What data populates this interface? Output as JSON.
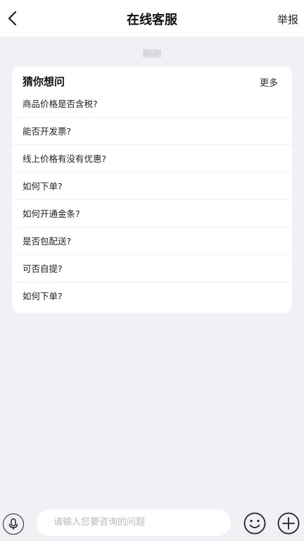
{
  "header": {
    "title": "在线客服",
    "report_label": "举报",
    "back_icon": "chevron-left-icon"
  },
  "chat": {
    "timestamp": "刚刚"
  },
  "faq_card": {
    "title": "猜你想问",
    "more_label": "更多",
    "questions": [
      "商品价格是否含税?",
      "能否开发票?",
      "线上价格有没有优惠?",
      "如何下单?",
      "如何开通金条?",
      "是否包配送?",
      "可否自提?",
      "如何下单?"
    ]
  },
  "input_bar": {
    "placeholder": "请输入您要咨询的问题",
    "voice_icon": "microphone-icon",
    "emoji_icon": "smiley-icon",
    "add_icon": "plus-circle-icon"
  },
  "colors": {
    "background": "#f0f1f4",
    "card": "#ffffff",
    "placeholder_text": "#b8b9bd",
    "timestamp_text": "#b5b7bc"
  }
}
